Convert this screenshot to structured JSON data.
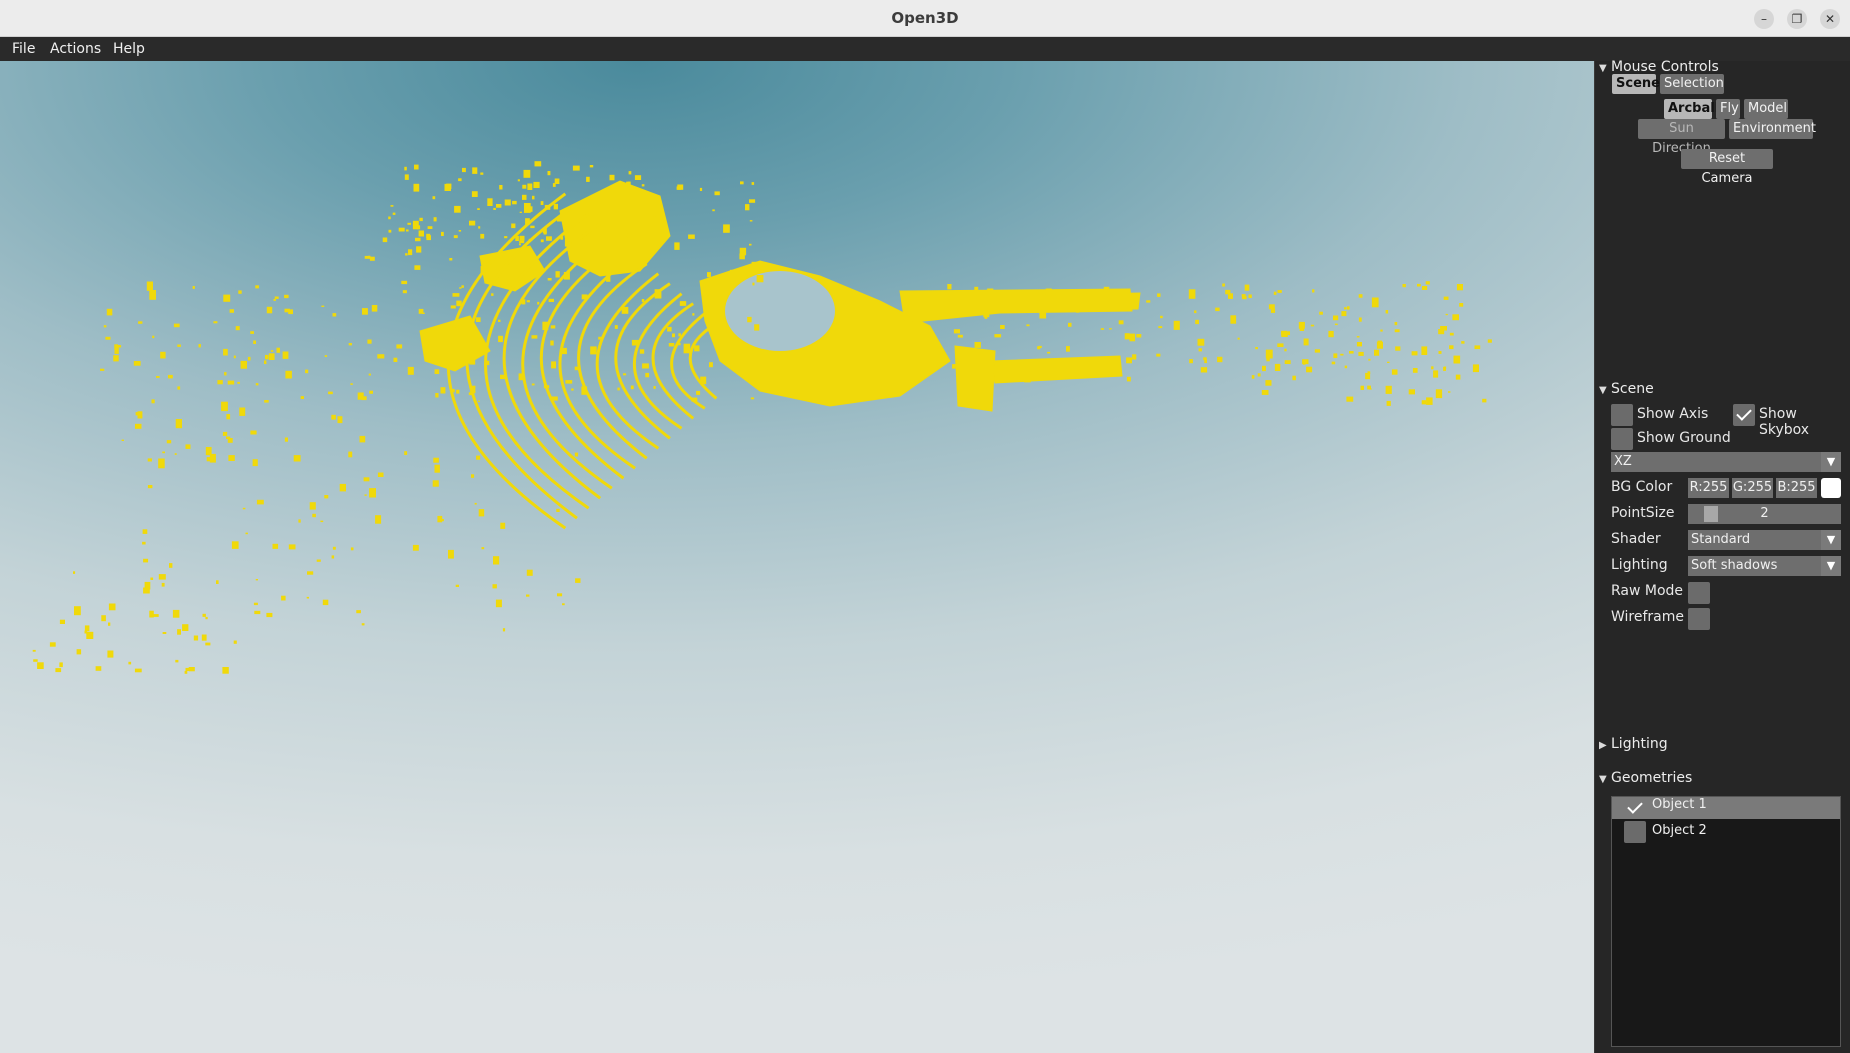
{
  "window": {
    "title": "Open3D"
  },
  "menu": [
    "File",
    "Actions",
    "Help"
  ],
  "colors": {
    "point_cloud": "#f0d90a",
    "panel_bg": "#262626",
    "button": "#6e6e6e",
    "active_button": "#b7b7b7"
  },
  "mouse_controls": {
    "header": "Mouse Controls",
    "tabs": [
      "Scene",
      "Selection"
    ],
    "modes": [
      "Arcball",
      "Fly",
      "Model"
    ],
    "active_mode": "Arcball",
    "light_modes": [
      "Sun Direction",
      "Environment"
    ],
    "reset_label": "Reset Camera"
  },
  "scene": {
    "header": "Scene",
    "show_axis": {
      "label": "Show Axis",
      "checked": false
    },
    "show_skybox": {
      "label": "Show Skybox",
      "checked": true
    },
    "show_ground": {
      "label": "Show Ground",
      "checked": false
    },
    "ground_plane": "XZ",
    "bg_color": {
      "label": "BG Color",
      "r": "R:255",
      "g": "G:255",
      "b": "B:255",
      "swatch": "#ffffff"
    },
    "point_size": {
      "label": "PointSize",
      "value": "2"
    },
    "shader": {
      "label": "Shader",
      "value": "Standard"
    },
    "lighting": {
      "label": "Lighting",
      "value": "Soft shadows"
    },
    "raw_mode": {
      "label": "Raw Mode",
      "checked": false
    },
    "wireframe": {
      "label": "Wireframe",
      "checked": false
    }
  },
  "lighting_section": {
    "header": "Lighting",
    "collapsed": true
  },
  "geometries": {
    "header": "Geometries",
    "items": [
      {
        "name": "Object 1",
        "checked": true,
        "selected": true
      },
      {
        "name": "Object 2",
        "checked": false,
        "selected": false
      }
    ]
  }
}
